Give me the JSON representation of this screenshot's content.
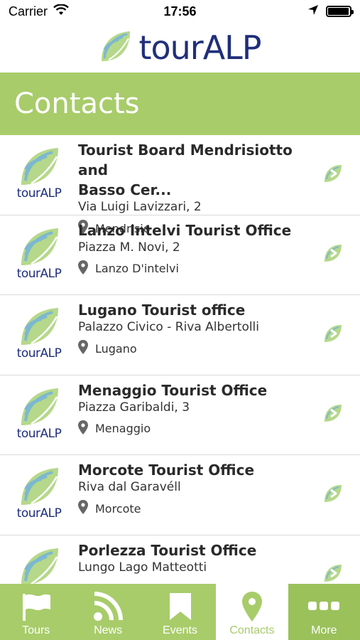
{
  "status_bar": {
    "carrier": "Carrier",
    "time": "17:56",
    "battery_level": 0.95
  },
  "header": {
    "brand": "tourALP"
  },
  "page": {
    "title": "Contacts"
  },
  "contacts": [
    {
      "title_line1": "Tourist Board Mendrisiotto and",
      "title_line2": "Basso Cer...",
      "address": "Via Luigi Lavizzari, 2",
      "city": "Mendrisio"
    },
    {
      "title_line1": "Lanzo Intelvi Tourist Office",
      "title_line2": "",
      "address": "Piazza M. Novi, 2",
      "city": "Lanzo D'intelvi"
    },
    {
      "title_line1": "Lugano Tourist office",
      "title_line2": "",
      "address": "Palazzo Civico - Riva Albertolli",
      "city": "Lugano"
    },
    {
      "title_line1": "Menaggio Tourist Office",
      "title_line2": "",
      "address": "Piazza Garibaldi, 3",
      "city": "Menaggio"
    },
    {
      "title_line1": "Morcote Tourist Office",
      "title_line2": "",
      "address": "Riva dal Garavéll",
      "city": "Morcote"
    },
    {
      "title_line1": "Porlezza Tourist Office",
      "title_line2": "",
      "address": "Lungo Lago Matteotti",
      "city": ""
    }
  ],
  "tabs": [
    {
      "label": "Tours",
      "icon": "flag-icon"
    },
    {
      "label": "News",
      "icon": "rss-icon"
    },
    {
      "label": "Events",
      "icon": "bookmark-icon"
    },
    {
      "label": "Contacts",
      "icon": "map-pin-icon"
    },
    {
      "label": "More",
      "icon": "more-icon"
    }
  ],
  "colors": {
    "accent": "#a8cc6a",
    "brand": "#1f2f7a",
    "more_tab": "#9bc15b"
  }
}
